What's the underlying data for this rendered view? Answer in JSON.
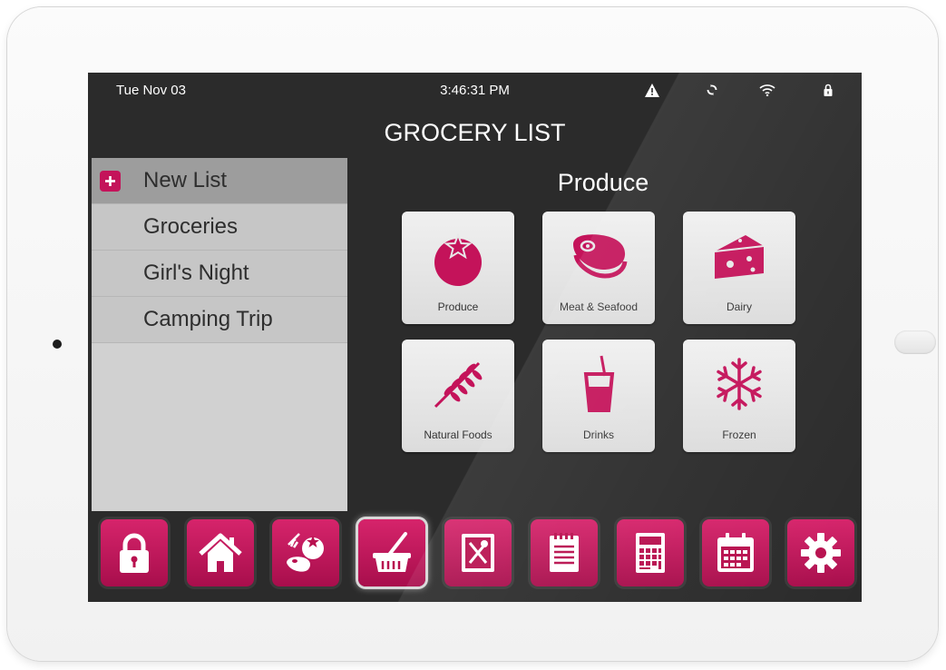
{
  "status_bar": {
    "date": "Tue Nov 03",
    "time": "3:46:31 PM",
    "icons": [
      "warning-icon",
      "sync-icon",
      "wifi-icon",
      "lock-icon"
    ]
  },
  "header": {
    "title": "GROCERY LIST"
  },
  "lists": {
    "new_list_label": "New List",
    "items": [
      "Groceries",
      "Girl's Night",
      "Camping Trip"
    ]
  },
  "category": {
    "title": "Produce",
    "tiles": [
      {
        "label": "Produce",
        "icon": "tomato-icon"
      },
      {
        "label": "Meat & Seafood",
        "icon": "steak-icon"
      },
      {
        "label": "Dairy",
        "icon": "cheese-icon"
      },
      {
        "label": "Natural Foods",
        "icon": "wheat-icon"
      },
      {
        "label": "Drinks",
        "icon": "drink-cup-icon"
      },
      {
        "label": "Frozen",
        "icon": "snowflake-icon"
      }
    ]
  },
  "dock": {
    "buttons": [
      "lock-icon",
      "home-icon",
      "food-icon",
      "basket-icon",
      "recipe-book-icon",
      "notepad-icon",
      "calculator-icon",
      "calendar-icon",
      "gear-icon"
    ],
    "active": "basket-icon"
  },
  "colors": {
    "accent": "#c4135a",
    "screen_bg": "#2b2b2b",
    "list_bg": "#d1d1d1",
    "tile_bg": "#e8e8e8"
  }
}
